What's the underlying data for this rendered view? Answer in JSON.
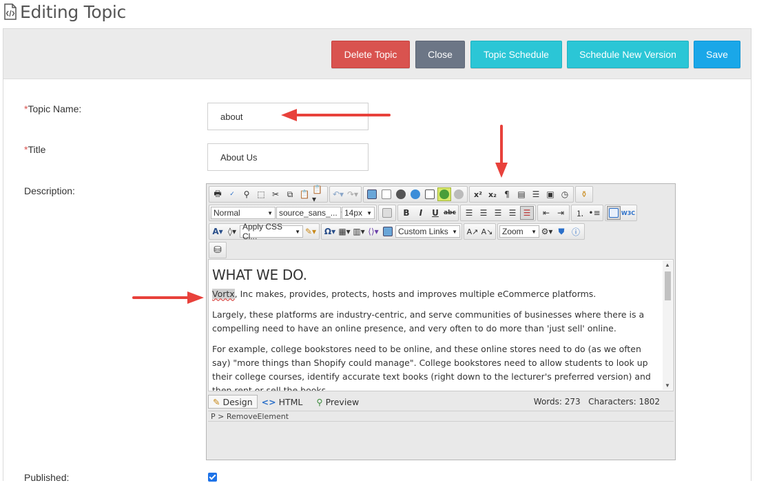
{
  "header": {
    "title": "Editing Topic",
    "icon": "code-file-icon"
  },
  "actions": {
    "delete": "Delete Topic",
    "close": "Close",
    "schedule": "Topic Schedule",
    "new_version": "Schedule New Version",
    "save": "Save"
  },
  "form": {
    "topic_name": {
      "required_mark": "*",
      "label": "Topic Name:",
      "value": "about"
    },
    "title": {
      "required_mark": "*",
      "label": "Title",
      "value": "About Us"
    },
    "description": {
      "label": "Description:"
    },
    "published": {
      "label": "Published:",
      "checked": true
    }
  },
  "editor": {
    "format_select": "Normal",
    "font_select": "source_sans_...",
    "size_select": "14px",
    "css_class_select": "Apply CSS Cl...",
    "links_select": "Custom Links",
    "zoom_select": "Zoom",
    "content": {
      "heading": "WHAT WE DO.",
      "highlight_word": "Vortx",
      "p1_rest": ", Inc makes, provides, protects, hosts and improves multiple eCommerce platforms.",
      "p2": "Largely, these platforms are industry-centric, and serve communities of businesses where there is a compelling need to have an online presence, and very often to do more than 'just sell' online.",
      "p3": "For example, college bookstores need to be online, and these online stores need to do (as we often say) \"more things than Shopify could manage\". College bookstores need to allow students to look up their college courses, identify accurate text books (right down to the lecturer's preferred version) and then rent or sell the books."
    },
    "modes": {
      "design": "Design",
      "html": "HTML",
      "preview": "Preview"
    },
    "stats": {
      "words": "Words: 273",
      "characters": "Characters: 1802"
    },
    "path": "P > RemoveElement"
  },
  "colors": {
    "delete": "#d9534f",
    "close": "#6c7686",
    "teal": "#2bc6d6",
    "save": "#1aa7e8",
    "arrow": "#e8413b"
  }
}
